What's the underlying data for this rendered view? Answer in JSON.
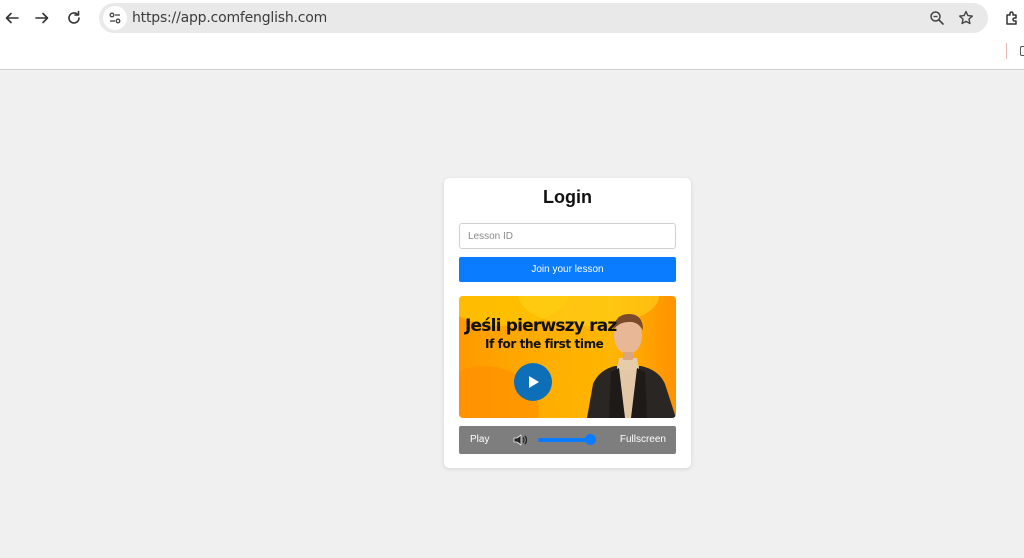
{
  "browser": {
    "url": "https://app.comfenglish.com"
  },
  "login": {
    "title": "Login",
    "lesson_id_placeholder": "Lesson ID",
    "lesson_id_value": "",
    "join_label": "Join your lesson"
  },
  "video": {
    "headline": "Jeśli pierwszy raz",
    "subline": "If for the first time"
  },
  "controls": {
    "play_label": "Play",
    "fullscreen_label": "Fullscreen",
    "volume": 1.0
  },
  "colors": {
    "accent": "#0a7cff",
    "play_button": "#0d6fb8",
    "controls_bg": "#7e7e7e",
    "page_bg": "#f0f0f0"
  },
  "icons": [
    "back-arrow-icon",
    "forward-arrow-icon",
    "reload-icon",
    "site-info-icon",
    "zoom-icon",
    "star-icon",
    "extensions-icon",
    "play-icon",
    "speaker-icon"
  ]
}
